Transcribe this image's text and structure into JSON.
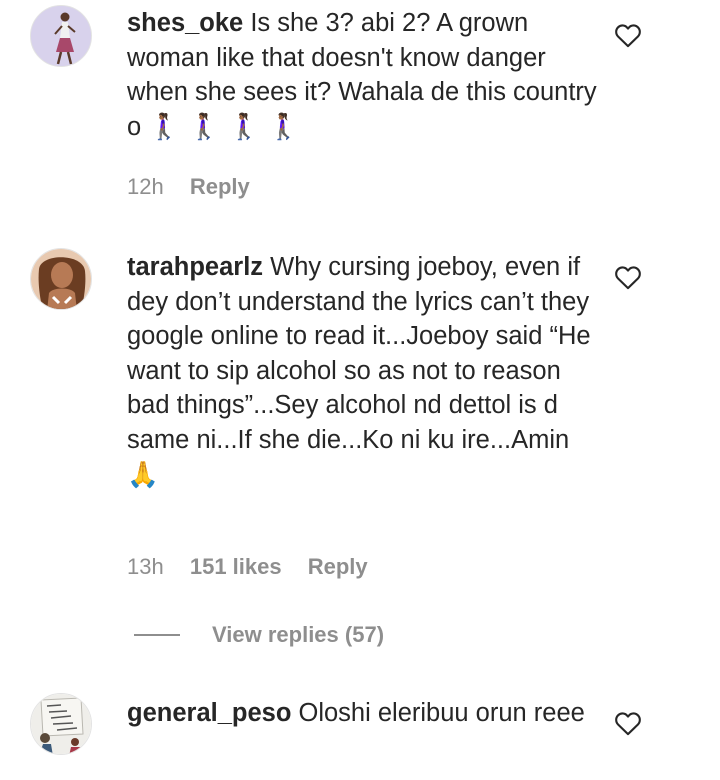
{
  "comments": [
    {
      "username": "shes_oke",
      "text": "Is she 3? abi 2? A grown woman like that doesn't know danger when she sees it? Wahala de this country o",
      "emoji": "🚶🏾‍♀️ 🚶🏾‍♀️ 🚶🏾‍♀️ 🚶🏾‍♀️",
      "time": "12h",
      "likes": "",
      "reply_label": "Reply"
    },
    {
      "username": "tarahpearlz",
      "text": "Why cursing joeboy, even if dey don’t understand the lyrics can’t they google online to read it...Joeboy said “He want to sip alcohol so as not to reason bad things”...Sey alcohol nd dettol is d same ni...If she die...Ko ni ku ire...Amin",
      "emoji": "🙏",
      "time": "13h",
      "likes": "151 likes",
      "reply_label": "Reply",
      "view_replies": "View replies (57)"
    },
    {
      "username": "general_peso",
      "text": "Oloshi eleribuu orun reee",
      "emoji": "",
      "time": "",
      "likes": "",
      "reply_label": ""
    }
  ],
  "icons": {
    "like": "heart-outline-icon"
  },
  "colors": {
    "text": "#262626",
    "secondary": "#8e8e8e",
    "background": "#ffffff"
  }
}
